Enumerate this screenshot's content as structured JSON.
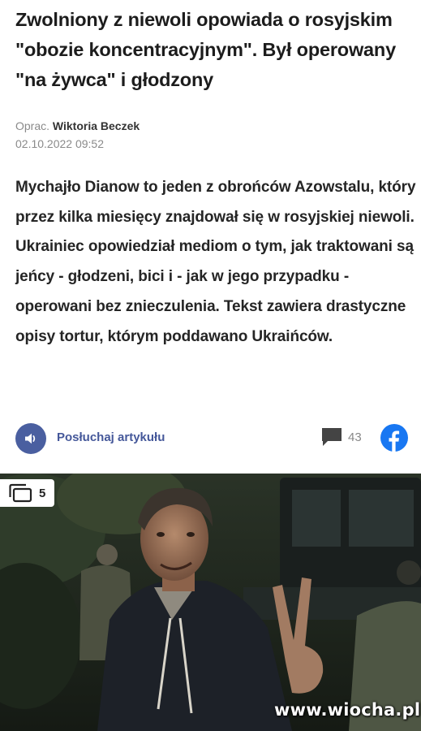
{
  "article": {
    "headline": "Zwolniony z niewoli opowiada o rosyjskim \"obozie koncentracyjnym\". Był operowany \"na żywca\" i głodzony",
    "meta": {
      "author_prefix": "Oprac.",
      "author_name": "Wiktoria Beczek",
      "date": "02.10.2022 09:52"
    },
    "lead": "Mychajło Dianow to jeden z obrońców Azowstalu, który przez kilka miesięcy znajdował się w rosyjskiej niewoli. Ukrainiec opowiedział mediom o tym, jak traktowani są jeńcy - głodzeni, bici i - jak w jego przypadku - operowani bez znieczulenia. Tekst zawiera drastyczne opisy tortur, którym poddawano Ukraińców."
  },
  "toolbar": {
    "listen_label": "Posłuchaj artykułu",
    "comments_count": "43"
  },
  "gallery": {
    "count": "5"
  },
  "watermark": "www.wiocha.pl",
  "colors": {
    "accent": "#4a5fa0",
    "facebook": "#1877f2",
    "meta_gray": "#8a8a8a"
  },
  "icons": {
    "audio": "speaker-icon",
    "comments": "speech-bubble-icon",
    "share": "facebook-icon",
    "gallery": "gallery-stack-icon"
  }
}
